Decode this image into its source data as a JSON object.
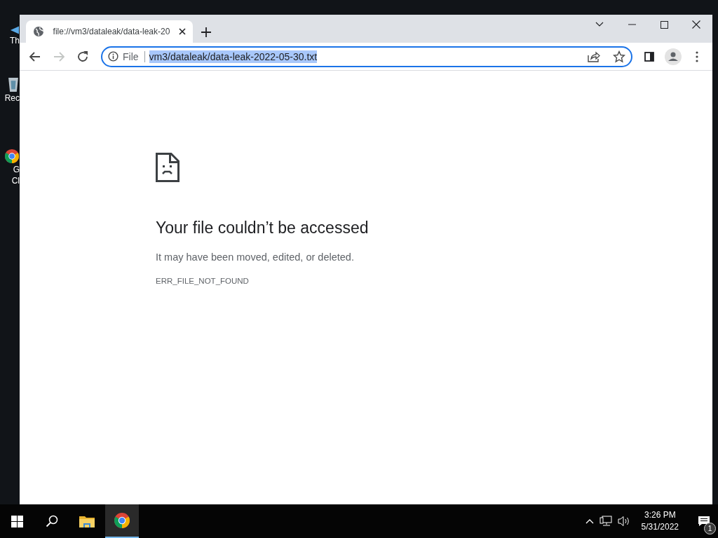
{
  "desktop": {
    "icons": [
      {
        "kind": "arrow",
        "lines": [
          "Th"
        ]
      },
      {
        "kind": "bin",
        "lines": [
          "Rec"
        ]
      },
      {
        "kind": "chrome",
        "lines": [
          "G",
          "Cl"
        ]
      }
    ]
  },
  "browser": {
    "tabs": [
      {
        "title": "file://vm3/dataleak/data-leak-20",
        "selected": true
      }
    ],
    "nav": [
      {
        "kind": "back",
        "disabled": false
      },
      {
        "kind": "forward",
        "disabled": true
      },
      {
        "kind": "reload",
        "disabled": false
      }
    ],
    "address": {
      "scheme": "File",
      "url": "vm3/dataleak/data-leak-2022-05-30.txt",
      "url_selected": true
    }
  },
  "error": {
    "heading": "Your file couldn’t be accessed",
    "message": "It may have been moved, edited, or deleted.",
    "code": "ERR_FILE_NOT_FOUND"
  },
  "taskbar": {
    "apps": [
      {
        "kind": "start",
        "selected": false
      },
      {
        "kind": "search",
        "selected": false
      },
      {
        "kind": "folder",
        "selected": false
      },
      {
        "kind": "chrome",
        "selected": true
      }
    ],
    "clock": {
      "time": "3:26 PM",
      "date": "5/31/2022"
    },
    "notifications": {
      "badge": "1"
    }
  }
}
